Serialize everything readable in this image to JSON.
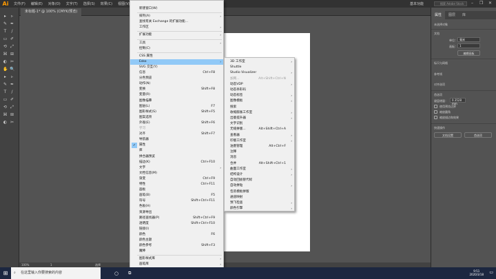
{
  "app": {
    "logo": "Ai",
    "menus": [
      "文件(F)",
      "编辑(E)",
      "对象(O)",
      "文字(T)",
      "选择(S)",
      "效果(C)",
      "视图(V)",
      "窗口(W)"
    ],
    "active_menu": "窗口(W)",
    "workspace": "基本功能",
    "search_placeholder": "搜索 Adobe Stock",
    "doc_tab": "未标题-1* @ 100% (CMYK/预览)"
  },
  "window_menu": {
    "items": [
      {
        "t": "新建窗口(W)"
      },
      {
        "sep": 1
      },
      {
        "t": "排列(A)",
        "ar": 1
      },
      {
        "t": "查找有关 Exchange 的扩展功能..."
      },
      {
        "t": "工作区",
        "ar": 1
      },
      {
        "sep": 1
      },
      {
        "t": "扩展功能",
        "ar": 1
      },
      {
        "sep": 1
      },
      {
        "t": "工具",
        "ar": 1
      },
      {
        "t": "控制(C)"
      },
      {
        "sep": 1
      },
      {
        "t": "CSS 属性"
      },
      {
        "t": "Esko",
        "ar": 1,
        "hl": 1
      },
      {
        "t": "SVG 交互(Y)"
      },
      {
        "t": "信息",
        "sc": "Ctrl+F8"
      },
      {
        "t": "分色预览"
      },
      {
        "t": "动作(N)"
      },
      {
        "t": "变换",
        "sc": "Shift+F8"
      },
      {
        "t": "变量(R)"
      },
      {
        "t": "图像描摹"
      },
      {
        "t": "图层(L)",
        "sc": "F7"
      },
      {
        "t": "图形样式(S)",
        "sc": "Shift+F5"
      },
      {
        "t": "图案选项"
      },
      {
        "t": "外观(E)",
        "sc": "Shift+F6"
      },
      {
        "t": "学习",
        "dis": 1
      },
      {
        "t": "对齐",
        "sc": "Shift+F7"
      },
      {
        "t": "导航器"
      },
      {
        "t": "属性",
        "ck": 1
      },
      {
        "t": "库"
      },
      {
        "t": "拼合器预览"
      },
      {
        "t": "描边(K)",
        "sc": "Ctrl+F10"
      },
      {
        "t": "文字",
        "ar": 1
      },
      {
        "t": "文档信息(M)"
      },
      {
        "t": "渐变",
        "sc": "Ctrl+F9"
      },
      {
        "t": "特性",
        "sc": "Ctrl+F11"
      },
      {
        "t": "画板"
      },
      {
        "t": "画笔(B)",
        "sc": "F5"
      },
      {
        "t": "符号",
        "sc": "Shift+Ctrl+F11"
      },
      {
        "t": "色板(H)"
      },
      {
        "t": "资源导出"
      },
      {
        "t": "路径查找器(P)",
        "sc": "Shift+Ctrl+F9"
      },
      {
        "t": "透明度",
        "sc": "Shift+Ctrl+F10"
      },
      {
        "t": "链接(I)"
      },
      {
        "t": "颜色",
        "sc": "F6"
      },
      {
        "t": "颜色主题"
      },
      {
        "t": "颜色参考",
        "sc": "Shift+F3"
      },
      {
        "t": "魔棒"
      },
      {
        "sep": 1
      },
      {
        "t": "图形样式库",
        "ar": 1
      },
      {
        "t": "画笔库",
        "ar": 1
      },
      {
        "t": "▾"
      }
    ]
  },
  "esko_submenu": {
    "items": [
      {
        "t": "3D 工作室",
        "ar": 1
      },
      {
        "t": "Shuttle"
      },
      {
        "t": "Studio Visualizer",
        "ar": 1
      },
      {
        "t": "加网...",
        "dis": 1,
        "sc": "Alt+Shift+Ctrl+N"
      },
      {
        "t": "动态VDP",
        "ar": 1
      },
      {
        "t": "动态条形码"
      },
      {
        "t": "动态标签",
        "ar": 1
      },
      {
        "t": "图像模板",
        "ar": 1
      },
      {
        "t": "搜索"
      },
      {
        "t": "收缩膨胀工作室",
        "ar": 1
      },
      {
        "t": "出版提升器",
        "ar": 1
      },
      {
        "t": "文字识别"
      },
      {
        "t": "无缝拼版...",
        "sc": "Alt+Shift+Ctrl+A"
      },
      {
        "t": "查看器",
        "ar": 1
      },
      {
        "t": "印版工作室",
        "ar": 1
      },
      {
        "t": "油墨管理",
        "sc": "Alt+Ctrl+F"
      },
      {
        "t": "注释"
      },
      {
        "t": "消息"
      },
      {
        "t": "合并",
        "sc": "Alt+Shift+Ctrl+1"
      },
      {
        "t": "曲面工作室",
        "ar": 1
      },
      {
        "t": "结构设计",
        "ar": 1
      },
      {
        "t": "自动回拢替代标"
      },
      {
        "t": "自动拼贴",
        "ar": 1
      },
      {
        "t": "包装模板拼版"
      },
      {
        "t": "通道映射"
      },
      {
        "t": "预飞检查",
        "ar": 1
      },
      {
        "t": "颜色引擎",
        "ar": 1
      }
    ]
  },
  "panel": {
    "tabs": [
      "属性",
      "图层",
      "库"
    ],
    "no_selection": "未选择对象",
    "document": "文档",
    "units_label": "单位：",
    "units_value": "毫米",
    "artboard_label": "画板：",
    "artboard_value": "1",
    "edit_artboard": "编辑画板",
    "rulers_grids": "标尺与网格",
    "guides": "参考线",
    "snap": "对齐选项",
    "preferences": "首选项",
    "keyboard_increment_label": "键盘增量：",
    "keyboard_increment": "0.3528 mm",
    "checkboxes": [
      "使用预览边界",
      "缩放圆角",
      "缩放描边和效果"
    ],
    "quick_actions": "快速操作",
    "doc_setup": "文档设置",
    "preferences_btn": "首选项"
  },
  "status": {
    "zoom": "100%",
    "artboard": "1",
    "tool": "选择"
  },
  "taskbar": {
    "search": "在这里输入你要搜索的内容",
    "time": "9:51",
    "date": "2020/3/18"
  }
}
